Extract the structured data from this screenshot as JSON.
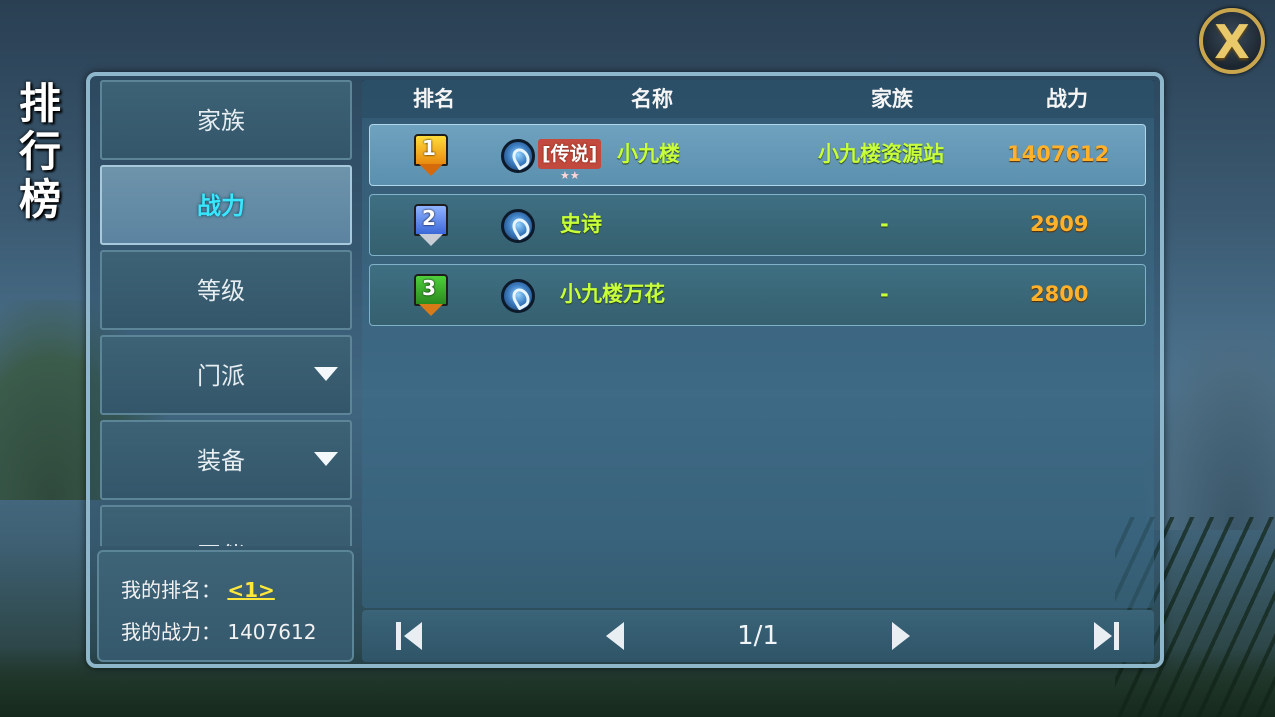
{
  "screen": {
    "title": "排行榜",
    "close_label": "X"
  },
  "tabs": [
    {
      "label": "家族",
      "active": false,
      "has_dropdown": false
    },
    {
      "label": "战力",
      "active": true,
      "has_dropdown": false
    },
    {
      "label": "等级",
      "active": false,
      "has_dropdown": false
    },
    {
      "label": "门派",
      "active": false,
      "has_dropdown": true
    },
    {
      "label": "装备",
      "active": false,
      "has_dropdown": true
    },
    {
      "label": "同伴",
      "active": false,
      "has_dropdown": false
    }
  ],
  "my_info": {
    "rank_label": "我的排名：",
    "rank_value": "<1>",
    "power_label": "我的战力：",
    "power_value": "1407612"
  },
  "table": {
    "headers": {
      "rank": "排名",
      "name": "名称",
      "family": "家族",
      "power": "战力"
    },
    "rows": [
      {
        "rank": "1",
        "tag": "[传说]",
        "tag_stars": "★★",
        "name": "小九楼",
        "family": "小九楼资源站",
        "power": "1407612",
        "medal_color": "gold",
        "icon": "class-emblem-icon"
      },
      {
        "rank": "2",
        "tag": "",
        "tag_stars": "",
        "name": "史诗",
        "family": "-",
        "power": "2909",
        "medal_color": "silver-blue",
        "icon": "class-emblem-icon"
      },
      {
        "rank": "3",
        "tag": "",
        "tag_stars": "",
        "name": "小九楼万花",
        "family": "-",
        "power": "2800",
        "medal_color": "green-bronze",
        "icon": "class-emblem-icon"
      }
    ]
  },
  "pager": {
    "page_text": "1/1",
    "icons": [
      "first-page-icon",
      "prev-page-icon",
      "next-page-icon",
      "last-page-icon"
    ]
  },
  "colors": {
    "active_tab_text": "#38e6ff",
    "name_text": "#c8ff3a",
    "power_text": "#ffb12a",
    "rank_highlight": "#ffe83a",
    "frame": "#8fb7cc",
    "close_gold": "#e9c96a"
  }
}
